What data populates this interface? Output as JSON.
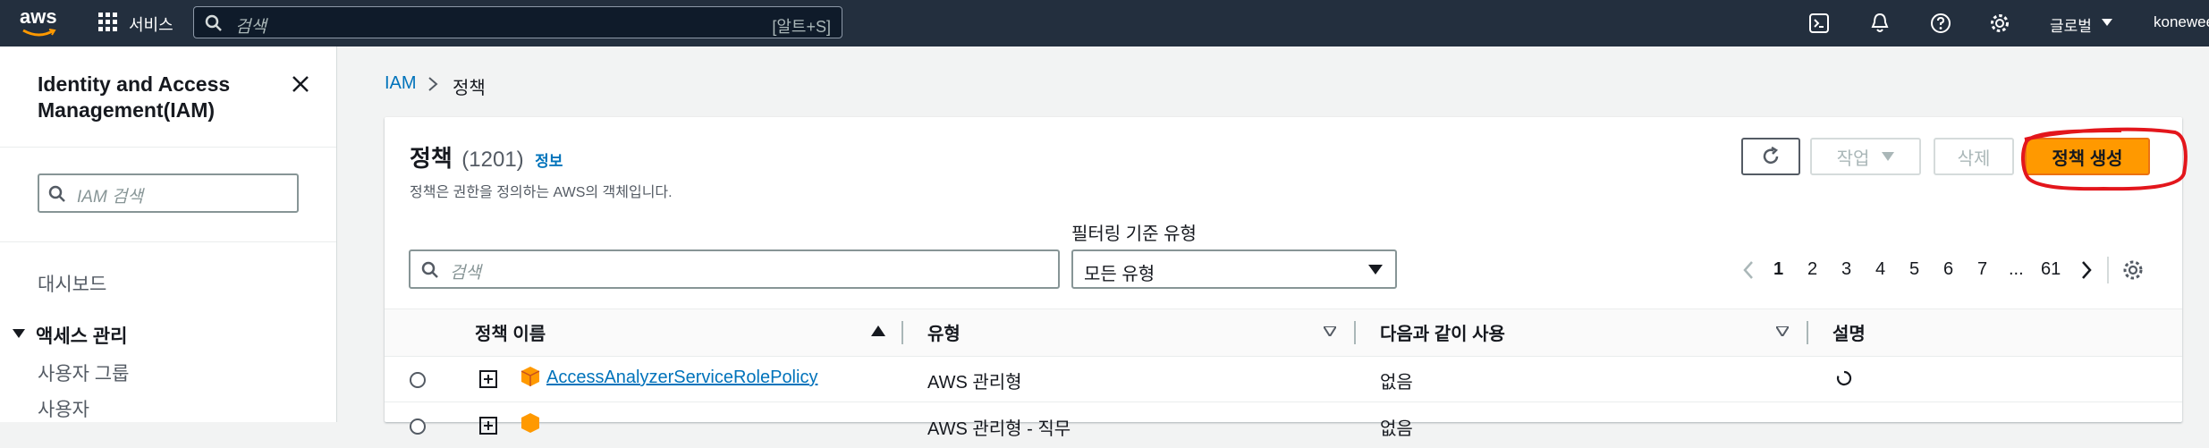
{
  "topnav": {
    "logo": "aws",
    "services_label": "서비스",
    "search_placeholder": "검색",
    "search_shortcut": "[알트+S]",
    "region_label": "글로벌",
    "account_label": "konewee"
  },
  "sidebar": {
    "title": "Identity and Access Management(IAM)",
    "search_placeholder": "IAM 검색",
    "dashboard": "대시보드",
    "section_access": "액세스 관리",
    "items": [
      "사용자 그룹",
      "사용자"
    ]
  },
  "breadcrumb": {
    "root": "IAM",
    "current": "정책"
  },
  "panel": {
    "title": "정책",
    "count": "(1201)",
    "info": "정보",
    "description": "정책은 권한을 정의하는 AWS의 객체입니다.",
    "actions_label": "작업",
    "delete_label": "삭제",
    "create_label": "정책 생성",
    "filter_label": "필터링 기준 유형",
    "filter_search_placeholder": "검색",
    "filter_type_value": "모든 유형",
    "pagination": [
      "1",
      "2",
      "3",
      "4",
      "5",
      "6",
      "7",
      "...",
      "61"
    ],
    "current_page": "1"
  },
  "table": {
    "columns": [
      "정책 이름",
      "유형",
      "다음과 같이 사용",
      "설명"
    ],
    "rows": [
      {
        "name": "AccessAnalyzerServiceRolePolicy",
        "type": "AWS 관리형",
        "used_as": "없음"
      },
      {
        "name": "",
        "type": "AWS 관리형 - 직무",
        "used_as": "없음"
      }
    ]
  },
  "colors": {
    "nav_bg": "#232f3e",
    "primary_button": "#ec7211",
    "link": "#0073bb",
    "annotation": "#e3161c"
  }
}
